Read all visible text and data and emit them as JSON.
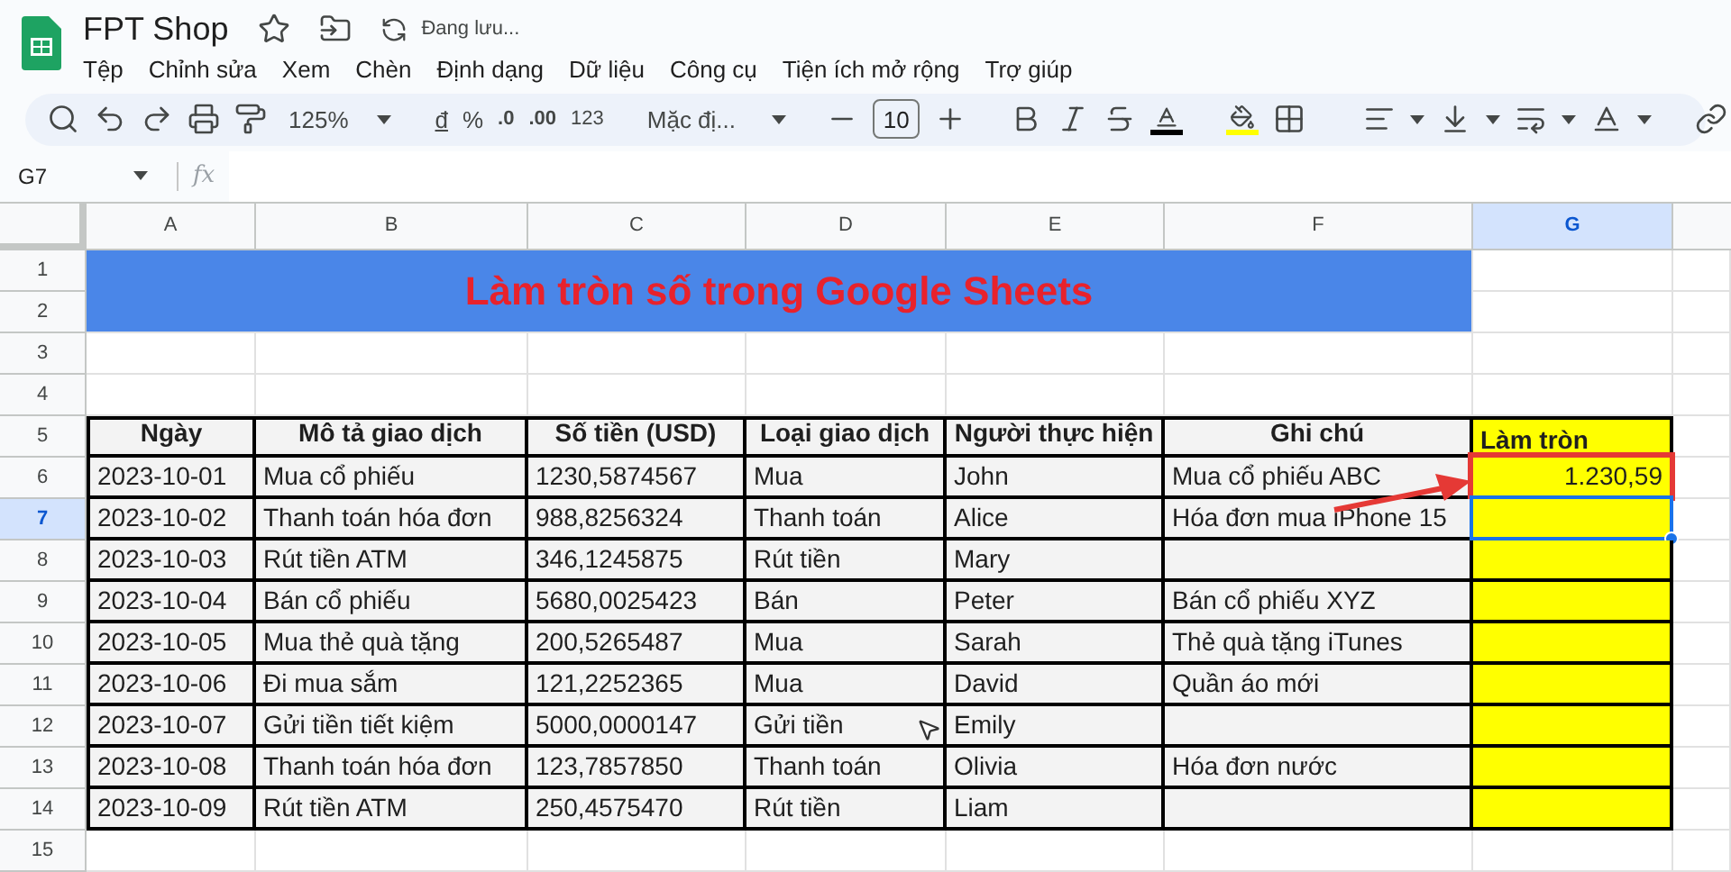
{
  "document": {
    "title": "FPT Shop",
    "save_status": "Đang lưu..."
  },
  "menu": [
    "Tệp",
    "Chỉnh sửa",
    "Xem",
    "Chèn",
    "Định dạng",
    "Dữ liệu",
    "Công cụ",
    "Tiện ích mở rộng",
    "Trợ giúp"
  ],
  "toolbar": {
    "zoom": "125%",
    "currency": "đ",
    "percent": "%",
    "decrease_decimal": ".0",
    "increase_decimal": ".00",
    "more_formats": "123",
    "font": "Mặc đị...",
    "font_size": "10"
  },
  "formula_bar": {
    "cell_ref": "G7",
    "fx": "fx"
  },
  "columns": [
    {
      "label": "A",
      "selected": false
    },
    {
      "label": "B",
      "selected": false
    },
    {
      "label": "C",
      "selected": false
    },
    {
      "label": "D",
      "selected": false
    },
    {
      "label": "E",
      "selected": false
    },
    {
      "label": "F",
      "selected": false
    },
    {
      "label": "G",
      "selected": true
    }
  ],
  "row_numbers": [
    {
      "label": "1",
      "selected": false
    },
    {
      "label": "2",
      "selected": false
    },
    {
      "label": "3",
      "selected": false
    },
    {
      "label": "4",
      "selected": false
    },
    {
      "label": "5",
      "selected": false
    },
    {
      "label": "6",
      "selected": false
    },
    {
      "label": "7",
      "selected": true
    },
    {
      "label": "8",
      "selected": false
    },
    {
      "label": "9",
      "selected": false
    },
    {
      "label": "10",
      "selected": false
    },
    {
      "label": "11",
      "selected": false
    },
    {
      "label": "12",
      "selected": false
    },
    {
      "label": "13",
      "selected": false
    },
    {
      "label": "14",
      "selected": false
    },
    {
      "label": "15",
      "selected": false
    }
  ],
  "sheet_title": "Làm tròn số trong Google Sheets",
  "table": {
    "headers": [
      "Ngày",
      "Mô tả giao dịch",
      "Số tiền (USD)",
      "Loại giao dịch",
      "Người thực hiện",
      "Ghi chú",
      "Làm tròn"
    ],
    "rows": [
      [
        "2023-10-01",
        "Mua cổ phiếu",
        "1230,5874567",
        "Mua",
        "John",
        "Mua cổ phiếu ABC",
        "1.230,59"
      ],
      [
        "2023-10-02",
        "Thanh toán hóa đơn",
        "988,8256324",
        "Thanh toán",
        "Alice",
        "Hóa đơn mua iPhone 15",
        ""
      ],
      [
        "2023-10-03",
        "Rút tiền ATM",
        "346,1245875",
        "Rút tiền",
        "Mary",
        "",
        ""
      ],
      [
        "2023-10-04",
        "Bán cổ phiếu",
        "5680,0025423",
        "Bán",
        "Peter",
        "Bán cổ phiếu XYZ",
        ""
      ],
      [
        "2023-10-05",
        "Mua thẻ quà tặng",
        "200,5265487",
        "Mua",
        "Sarah",
        "Thẻ quà tặng iTunes",
        ""
      ],
      [
        "2023-10-06",
        "Đi mua sắm",
        "121,2252365",
        "Mua",
        "David",
        "Quần áo mới",
        ""
      ],
      [
        "2023-10-07",
        "Gửi tiền tiết kiệm",
        "5000,0000147",
        "Gửi tiền",
        "Emily",
        "",
        ""
      ],
      [
        "2023-10-08",
        "Thanh toán hóa đơn",
        "123,7857850",
        "Thanh toán",
        "Olivia",
        "Hóa đơn nước",
        ""
      ],
      [
        "2023-10-09",
        "Rút tiền ATM",
        "250,4575470",
        "Rút tiền",
        "Liam",
        "",
        ""
      ]
    ]
  }
}
